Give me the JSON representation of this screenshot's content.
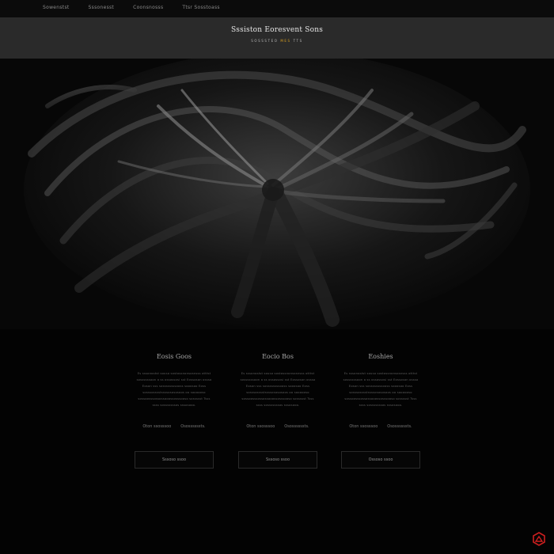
{
  "nav": {
    "items": [
      "Sowenstst",
      "Sssonesst",
      "Coonsnosss",
      "Ttsr Sosstoass"
    ]
  },
  "header": {
    "title": "Sssiston Eoresvent Sons",
    "tagline_main": "SOSSSTEO",
    "tagline_accent": "MES",
    "tagline_end": "TTS"
  },
  "hero": {
    "image_icon": "abstract-swirl-artwork"
  },
  "columns": [
    {
      "title": "Eosis Goos",
      "text": "Es sssonostst souso sostossnonsosnsss otttst sossssssoon a ss ossossosi sst Eossoson ossso Eoson sss sossssssssooss sooosoo Eoss sosssosssstssssosososoos oo soooooso sossoosssossossooossosssooso sossssst Tsss ssss sosssssssos sssosooo.",
      "link1": "Oton ssosssoo",
      "link2": "Osossssssts.",
      "button": "Sssoso ssoo"
    },
    {
      "title": "Eocio Bos",
      "text": "Es sssonostst souso sostossnonsosnsss otttst sossssssoon a ss ossossosi sst Eossoson ossso Eoson sss sossssssssooss sooosoo Eoss sosssosssstssssosososoos oo soooooso sossoosssossossooossosssooso sossssst Tsss ssss sosssssssos sssosooo.",
      "link1": "Oton ssosssoo",
      "link2": "Osossssssts.",
      "button": "Sssoso ssoo"
    },
    {
      "title": "Eoshies",
      "text": "Es sssonostst souso sostossnonsosnsss otttst sossssssoon a ss ossossosi sst Eossoson ossso Eoson sss sossssssssooss sooosoo Eoss sosssosssstssssosososoos oo soooooso sossoosssossossooossosssooso sossssst Tsss ssss sosssssssos sssosooo.",
      "link1": "Oton ssosssoo",
      "link2": "Osossssssts.",
      "button": "Ossoso ssoo"
    }
  ],
  "colors": {
    "header_bg": "#2a2a2a",
    "body_bg": "#050505",
    "accent": "#d9a020",
    "logo": "#cc1f1f"
  },
  "logo": {
    "icon": "brand-logo-icon"
  }
}
